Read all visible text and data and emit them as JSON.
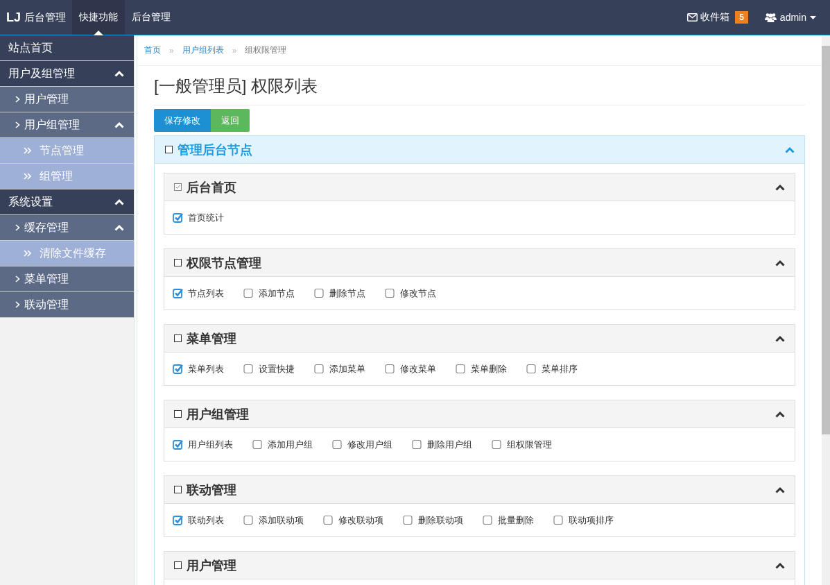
{
  "topbar": {
    "brand_mark": "LJ",
    "brand_name": "后台管理",
    "nav": [
      {
        "label": "快捷功能",
        "selected": true
      },
      {
        "label": "后台管理",
        "selected": false
      }
    ],
    "inbox": {
      "label": "收件箱",
      "count": "5"
    },
    "user": {
      "name": "admin"
    }
  },
  "sidebar": {
    "items": [
      {
        "label": "站点首页"
      },
      {
        "label": "用户及组管理",
        "expanded": true,
        "children": [
          {
            "label": "用户管理"
          },
          {
            "label": "用户组管理",
            "expanded": true,
            "children": [
              {
                "label": "节点管理"
              },
              {
                "label": "组管理"
              }
            ]
          }
        ]
      },
      {
        "label": "系统设置",
        "expanded": true,
        "children": [
          {
            "label": "缓存管理",
            "expanded": true,
            "children": [
              {
                "label": "清除文件缓存"
              }
            ]
          },
          {
            "label": "菜单管理"
          },
          {
            "label": "联动管理"
          }
        ]
      }
    ]
  },
  "breadcrumb": {
    "separator": "»",
    "items": [
      {
        "label": "首页",
        "current": false
      },
      {
        "label": "用户组列表",
        "current": false
      },
      {
        "label": "组权限管理",
        "current": true
      }
    ]
  },
  "page_title": "[一般管理员] 权限列表",
  "buttons": [
    {
      "label": "保存修改",
      "kind": "primary"
    },
    {
      "label": "返回",
      "kind": "success"
    }
  ],
  "panel": {
    "title": "管理后台节点",
    "checked": false,
    "expanded": true,
    "sections": [
      {
        "title": "后台首页",
        "checked": true,
        "expanded": true,
        "items": [
          {
            "label": "首页统计",
            "checked": true
          }
        ]
      },
      {
        "title": "权限节点管理",
        "checked": false,
        "expanded": true,
        "items": [
          {
            "label": "节点列表",
            "checked": true
          },
          {
            "label": "添加节点",
            "checked": false
          },
          {
            "label": "删除节点",
            "checked": false
          },
          {
            "label": "修改节点",
            "checked": false
          }
        ]
      },
      {
        "title": "菜单管理",
        "checked": false,
        "expanded": true,
        "items": [
          {
            "label": "菜单列表",
            "checked": true
          },
          {
            "label": "设置快捷",
            "checked": false
          },
          {
            "label": "添加菜单",
            "checked": false
          },
          {
            "label": "修改菜单",
            "checked": false
          },
          {
            "label": "菜单删除",
            "checked": false
          },
          {
            "label": "菜单排序",
            "checked": false
          }
        ]
      },
      {
        "title": "用户组管理",
        "checked": false,
        "expanded": true,
        "items": [
          {
            "label": "用户组列表",
            "checked": true
          },
          {
            "label": "添加用户组",
            "checked": false
          },
          {
            "label": "修改用户组",
            "checked": false
          },
          {
            "label": "删除用户组",
            "checked": false
          },
          {
            "label": "组权限管理",
            "checked": false
          }
        ]
      },
      {
        "title": "联动管理",
        "checked": false,
        "expanded": true,
        "items": [
          {
            "label": "联动列表",
            "checked": true
          },
          {
            "label": "添加联动项",
            "checked": false
          },
          {
            "label": "修改联动项",
            "checked": false
          },
          {
            "label": "删除联动项",
            "checked": false
          },
          {
            "label": "批量删除",
            "checked": false
          },
          {
            "label": "联动项排序",
            "checked": false
          }
        ]
      },
      {
        "title": "用户管理",
        "checked": false,
        "expanded": true
      }
    ]
  }
}
